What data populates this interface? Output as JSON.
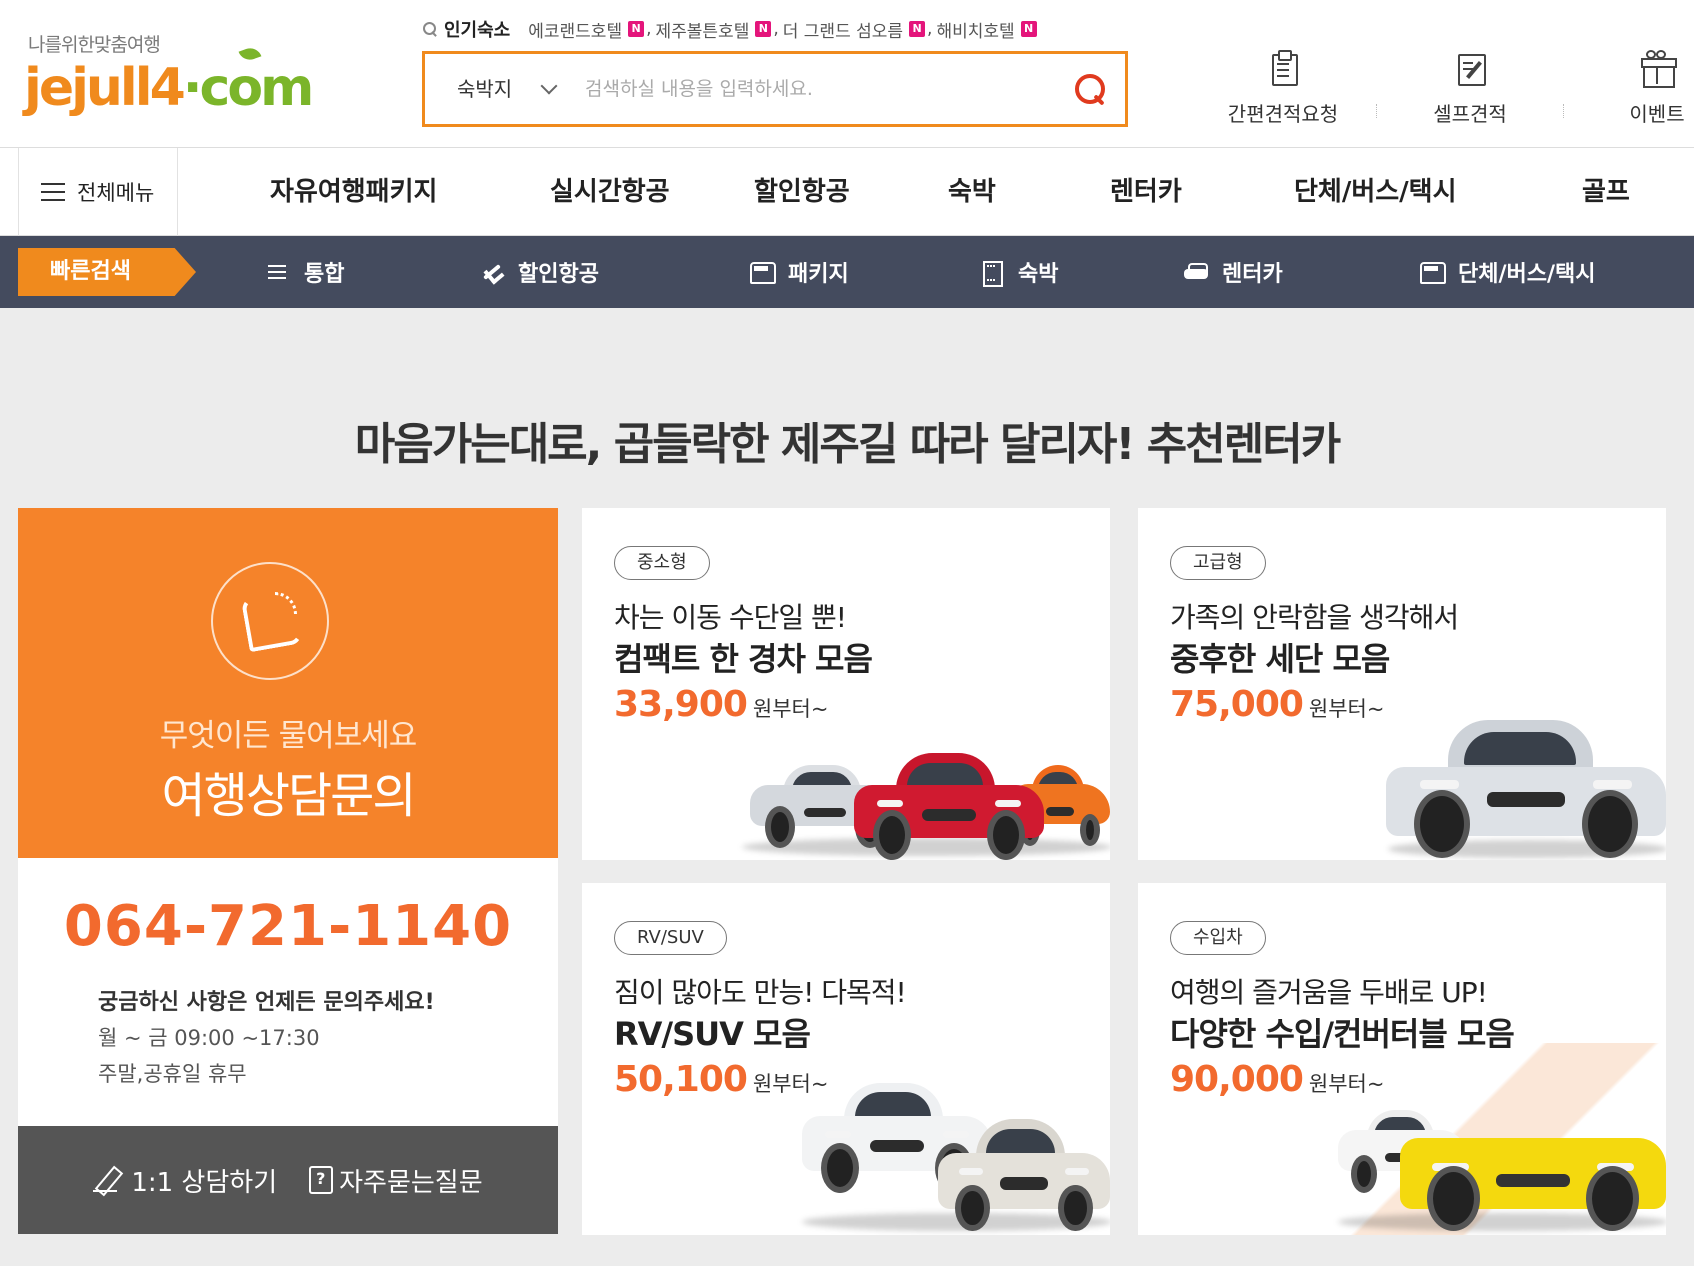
{
  "header": {
    "logo_tagline": "나를위한맞춤여행",
    "logo_text_a": "jejull4",
    "logo_text_b": "·com",
    "popular_label": "인기숙소",
    "popular_items": [
      {
        "name": "에코랜드호텔",
        "badge": "N"
      },
      {
        "name": "제주볼튼호텔",
        "badge": "N"
      },
      {
        "name": "더 그랜드 섬오름",
        "badge": "N"
      },
      {
        "name": "해비치호텔",
        "badge": "N"
      }
    ],
    "search": {
      "category": "숙박지",
      "placeholder": "검색하실 내용을 입력하세요."
    },
    "quick_links": [
      {
        "label": "간편견적요청",
        "icon": "clipboard-icon"
      },
      {
        "label": "셀프견적",
        "icon": "edit-note-icon"
      },
      {
        "label": "이벤트",
        "icon": "gift-icon"
      }
    ]
  },
  "main_nav": {
    "all_menu": "전체메뉴",
    "items": [
      "자유여행패키지",
      "실시간항공",
      "할인항공",
      "숙박",
      "렌터카",
      "단체/버스/택시",
      "골프"
    ]
  },
  "quick_bar": {
    "label": "빠른검색",
    "items": [
      {
        "label": "통합",
        "icon": "list-icon"
      },
      {
        "label": "할인항공",
        "icon": "plane-icon"
      },
      {
        "label": "패키지",
        "icon": "bus-icon"
      },
      {
        "label": "숙박",
        "icon": "building-icon"
      },
      {
        "label": "렌터카",
        "icon": "car-icon"
      },
      {
        "label": "단체/버스/택시",
        "icon": "bus-icon"
      }
    ]
  },
  "section": {
    "title": "마음가는대로, 곱들락한 제주길 따라 달리자! 추천렌터카"
  },
  "contact": {
    "sub": "무엇이든 물어보세요",
    "main": "여행상담문의",
    "phone": "064-721-1140",
    "line1": "궁금하신 사항은 언제든 문의주세요!",
    "line2": "월 ~ 금 09:00 ~17:30",
    "line3": "주말,공휴일 휴무",
    "btn_consult": "1:1 상담하기",
    "btn_faq": "자주묻는질문"
  },
  "cards": [
    {
      "badge": "중소형",
      "line1": "차는 이동 수단일 뿐!",
      "line2": "컴팩트 한 경차 모음",
      "price": "33,900",
      "suffix": "원부터~"
    },
    {
      "badge": "고급형",
      "line1": "가족의 안락함을 생각해서",
      "line2": "중후한 세단 모음",
      "price": "75,000",
      "suffix": "원부터~"
    },
    {
      "badge": "RV/SUV",
      "line1": "짐이 많아도 만능! 다목적!",
      "line2": "RV/SUV 모음",
      "price": "50,100",
      "suffix": "원부터~"
    },
    {
      "badge": "수입차",
      "line1": "여행의 즐거움을 두배로 UP!",
      "line2": "다양한 수입/컨버터블 모음",
      "price": "90,000",
      "suffix": "원부터~"
    }
  ],
  "colors": {
    "brand_orange": "#f08a1d",
    "brand_green": "#7bb52a",
    "price_orange": "#f26a2e",
    "quickbar_bg": "#444b5e",
    "badge_pink": "#e4157b"
  }
}
